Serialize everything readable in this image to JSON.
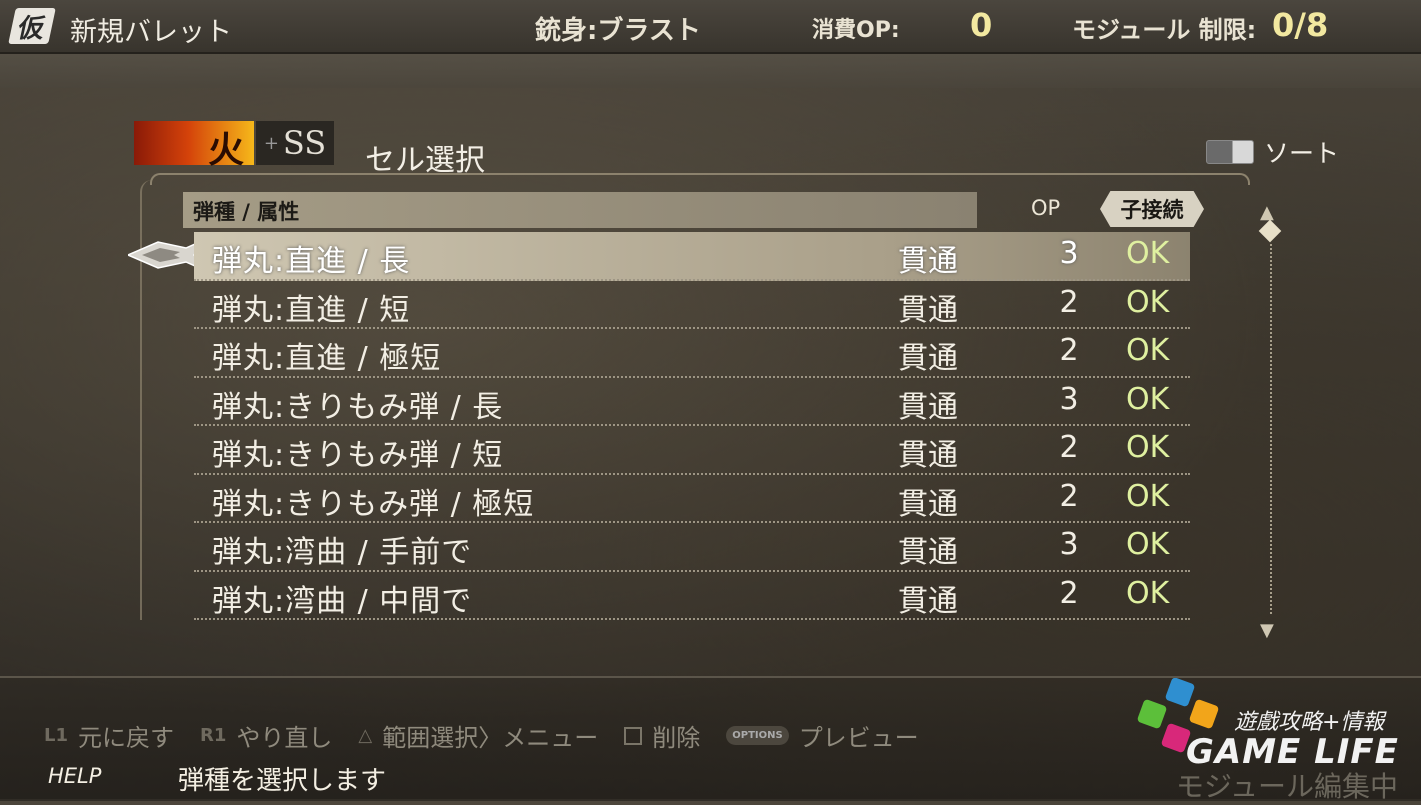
{
  "header": {
    "app_badge": "仮",
    "title": "新規バレット",
    "barrel": "銃身:ブラスト",
    "op_label": "消費OP:",
    "op_value": "0",
    "module_label": "モジュール 制限:",
    "module_value": "0/8"
  },
  "panel": {
    "element_label": "火",
    "size_label": "SS",
    "title": "セル選択",
    "sort_label": "ソート"
  },
  "table": {
    "col_type": "弾種 / 属性",
    "col_op": "OP",
    "col_child": "子接続",
    "rows": [
      {
        "name": "弾丸:直進 / 長",
        "attr": "貫通",
        "op": "3",
        "child": "OK"
      },
      {
        "name": "弾丸:直進 / 短",
        "attr": "貫通",
        "op": "2",
        "child": "OK"
      },
      {
        "name": "弾丸:直進 / 極短",
        "attr": "貫通",
        "op": "2",
        "child": "OK"
      },
      {
        "name": "弾丸:きりもみ弾 / 長",
        "attr": "貫通",
        "op": "3",
        "child": "OK"
      },
      {
        "name": "弾丸:きりもみ弾 / 短",
        "attr": "貫通",
        "op": "2",
        "child": "OK"
      },
      {
        "name": "弾丸:きりもみ弾 / 極短",
        "attr": "貫通",
        "op": "2",
        "child": "OK"
      },
      {
        "name": "弾丸:湾曲 / 手前で",
        "attr": "貫通",
        "op": "3",
        "child": "OK"
      },
      {
        "name": "弾丸:湾曲 / 中間で",
        "attr": "貫通",
        "op": "2",
        "child": "OK"
      }
    ]
  },
  "controls": {
    "undo_key": "L1",
    "undo": "元に戻す",
    "redo_key": "R1",
    "redo": "やり直し",
    "range_key": "△",
    "range": "範囲選択〉メニュー",
    "delete": "削除",
    "options_key": "OPTIONS",
    "preview": "プレビュー"
  },
  "help": {
    "label": "HELP",
    "text": "弾種を選択します"
  },
  "watermark": {
    "cn": "遊戲攻略+情報",
    "en": "GAME LIFE",
    "status": "モジュール編集中"
  },
  "colors": {
    "accent_yellow": "#f2e8a0",
    "ok_green": "#dff0a0",
    "selected_row": "#cfc7b2"
  }
}
